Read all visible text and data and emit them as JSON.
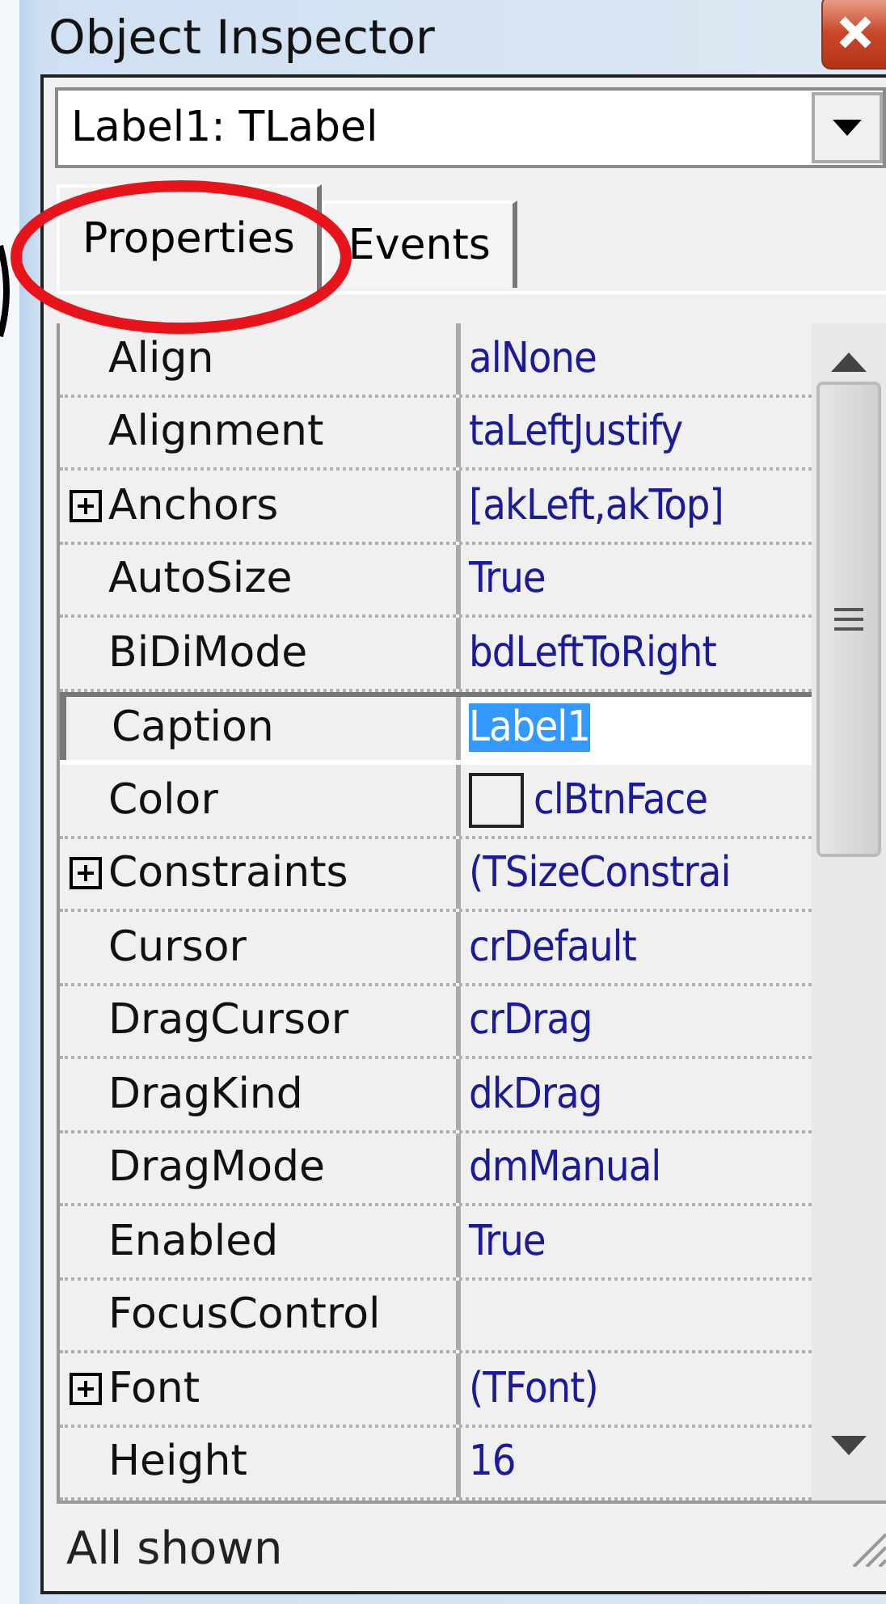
{
  "window": {
    "title": "Object Inspector"
  },
  "object_selector": {
    "value": "Label1: TLabel"
  },
  "tabs": [
    {
      "label": "Properties",
      "selected": true
    },
    {
      "label": "Events",
      "selected": false
    }
  ],
  "properties": [
    {
      "name": "Align",
      "value": "alNone",
      "expandable": false,
      "selected": false
    },
    {
      "name": "Alignment",
      "value": "taLeftJustify",
      "expandable": false,
      "selected": false
    },
    {
      "name": "Anchors",
      "value": "[akLeft,akTop]",
      "expandable": true,
      "selected": false
    },
    {
      "name": "AutoSize",
      "value": "True",
      "expandable": false,
      "selected": false
    },
    {
      "name": "BiDiMode",
      "value": "bdLeftToRight",
      "expandable": false,
      "selected": false
    },
    {
      "name": "Caption",
      "value": "Label1",
      "expandable": false,
      "selected": true
    },
    {
      "name": "Color",
      "value": "clBtnFace",
      "expandable": false,
      "selected": false,
      "kind": "color"
    },
    {
      "name": "Constraints",
      "value": "(TSizeConstrai",
      "expandable": true,
      "selected": false
    },
    {
      "name": "Cursor",
      "value": "crDefault",
      "expandable": false,
      "selected": false
    },
    {
      "name": "DragCursor",
      "value": "crDrag",
      "expandable": false,
      "selected": false
    },
    {
      "name": "DragKind",
      "value": "dkDrag",
      "expandable": false,
      "selected": false
    },
    {
      "name": "DragMode",
      "value": "dmManual",
      "expandable": false,
      "selected": false
    },
    {
      "name": "Enabled",
      "value": "True",
      "expandable": false,
      "selected": false
    },
    {
      "name": "FocusControl",
      "expandable": false,
      "selected": false
    },
    {
      "name": "Font",
      "value": "(TFont)",
      "expandable": true,
      "selected": false
    },
    {
      "name": "Height",
      "value": "16",
      "expandable": false,
      "selected": false
    }
  ],
  "status_bar": {
    "text": "All shown"
  }
}
